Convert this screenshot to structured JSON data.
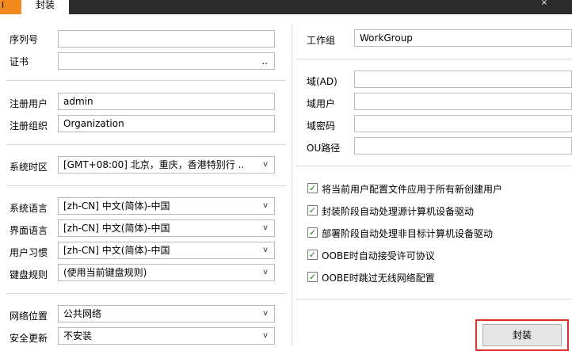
{
  "window": {
    "app_icon_text": "I",
    "tab_label": "封装",
    "close_icon": "×"
  },
  "left": {
    "serial_label": "序列号",
    "serial_value": "",
    "cert_label": "证书",
    "cert_value": "",
    "cert_browse": "..",
    "reg_user_label": "注册用户",
    "reg_user_value": "admin",
    "reg_org_label": "注册组织",
    "reg_org_value": "Organization",
    "timezone_label": "系统时区",
    "timezone_value": "[GMT+08:00] 北京，重庆，香港特别行 ..",
    "sys_lang_label": "系统语言",
    "sys_lang_value": "[zh-CN] 中文(简体)-中国",
    "ui_lang_label": "界面语言",
    "ui_lang_value": "[zh-CN] 中文(简体)-中国",
    "locale_label": "用户习惯",
    "locale_value": "[zh-CN] 中文(简体)-中国",
    "keyboard_label": "键盘规则",
    "keyboard_value": "(使用当前键盘规则)",
    "net_loc_label": "网络位置",
    "net_loc_value": "公共网络",
    "update_label": "安全更新",
    "update_value": "不安装",
    "dropdown_arrow": "v"
  },
  "right": {
    "workgroup_label": "工作组",
    "workgroup_value": "WorkGroup",
    "domain_label": "域(AD)",
    "domain_value": "",
    "domain_user_label": "域用户",
    "domain_user_value": "",
    "domain_pass_label": "域密码",
    "domain_pass_value": "",
    "ou_label": "OU路径",
    "ou_value": "",
    "checkbox_mark": "✓",
    "options": [
      {
        "label": "将当前用户配置文件应用于所有新创建用户",
        "checked": true
      },
      {
        "label": "封装阶段自动处理源计算机设备驱动",
        "checked": true
      },
      {
        "label": "部署阶段自动处理非目标计算机设备驱动",
        "checked": true
      },
      {
        "label": "OOBE时自动接受许可协议",
        "checked": true
      },
      {
        "label": "OOBE时跳过无线网络配置",
        "checked": true
      }
    ],
    "seal_button_label": "封装"
  }
}
